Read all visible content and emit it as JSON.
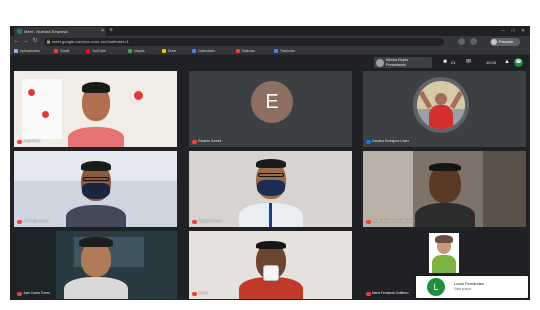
{
  "browser": {
    "tab_title": "Meet - Nuestra Empresa",
    "tab_close": "×",
    "new_tab": "+",
    "url": "meet.google.com/xxx-xxxx-xxx?authuser=1",
    "bookmarks": [
      {
        "label": "Aplicaciones",
        "color": "#8ab4f8"
      },
      {
        "label": "Gmail",
        "color": "#ea4335"
      },
      {
        "label": "YouTube",
        "color": "#ff0000"
      },
      {
        "label": "Mapas",
        "color": "#34a853"
      },
      {
        "label": "Drive",
        "color": "#fbbc04"
      },
      {
        "label": "Calendario",
        "color": "#4285f4"
      },
      {
        "label": "Noticias",
        "color": "#ea4335"
      },
      {
        "label": "Traductor",
        "color": "#4285f4"
      }
    ],
    "profile_label": "Pausada"
  },
  "meet": {
    "pinned_label": "Mónica Reyes",
    "pinned_sub": "Presentando",
    "participant_count": "21",
    "header_time": "10:25"
  },
  "tiles": [
    {
      "name": "Jorge Pérez",
      "mic": "off",
      "bg": "#f1ece6",
      "shirt": "#e57373",
      "skin": "#b07050",
      "hair": "#1b1b1b"
    },
    {
      "name": "Eduardo Gómez",
      "mic": "off",
      "avatar_letter": "E"
    },
    {
      "name": "Carolina Rodríguez López",
      "mic": "on",
      "avatar": "photo"
    },
    {
      "name": "Luis Felipe Castro",
      "mic": "off",
      "bg": "#cfd5de",
      "shirt": "#424a5a",
      "skin": "#8a5a3c",
      "hair": "#1b1b1b"
    },
    {
      "name": "Andrés Martínez",
      "mic": "off",
      "bg": "#d7d3cf",
      "shirt": "#e9eef3",
      "skin": "#9b6a4a",
      "hair": "#1b1b1b"
    },
    {
      "name": "Daniel Ramírez (Coordinador)",
      "mic": "off",
      "bg": "#7d7368",
      "shirt": "#2c2c2c",
      "skin": "#5b3a25",
      "hair": "#151515"
    },
    {
      "name": "Juan Carlos Torres",
      "mic": "off",
      "bg": "#2b3b42",
      "shirt": "#d9d9d9",
      "skin": "#b07a58",
      "hair": "#1e1e1e"
    },
    {
      "name": "Camilo",
      "mic": "off",
      "bg": "#e6e1dc",
      "shirt": "#c0392b",
      "skin": "#6b4530",
      "hair": "#151515"
    },
    {
      "name": "María Fernanda Gutiérrez",
      "mic": "off",
      "bg": "#ffffff"
    }
  ],
  "self_view": {
    "initial": "L",
    "name": "Lucía Fernández",
    "sub": "Vista propia"
  }
}
